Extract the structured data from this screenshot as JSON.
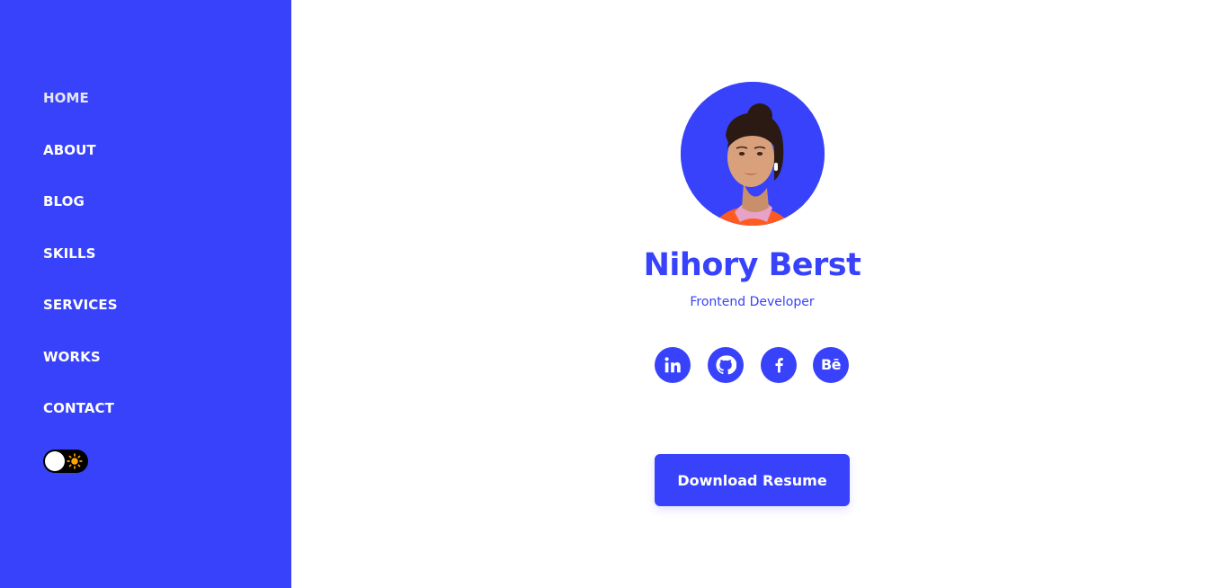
{
  "colors": {
    "accent": "#3742fa",
    "background": "#ffffff",
    "toggle_track": "#000000",
    "sun": "#ffa502"
  },
  "sidebar": {
    "nav": [
      {
        "label": "HOME",
        "active": true
      },
      {
        "label": "ABOUT"
      },
      {
        "label": "BLOG"
      },
      {
        "label": "SKILLS"
      },
      {
        "label": "SERVICES"
      },
      {
        "label": "WORKS"
      },
      {
        "label": "CONTACT"
      }
    ],
    "theme_toggle": {
      "icon": "sun-icon",
      "state": "light"
    }
  },
  "profile": {
    "name": "Nihory Berst",
    "role": "Frontend Developer",
    "avatar_icon": "avatar-photo",
    "social": [
      {
        "icon": "linkedin-icon",
        "text": "in"
      },
      {
        "icon": "github-icon"
      },
      {
        "icon": "facebook-icon",
        "text": "f"
      },
      {
        "icon": "behance-icon",
        "text": "Bē"
      }
    ],
    "download_label": "Download Resume"
  }
}
